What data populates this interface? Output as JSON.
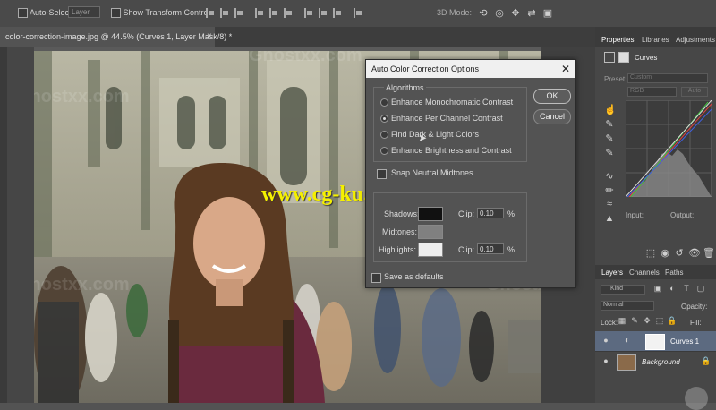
{
  "options_bar": {
    "auto_select_label": "Auto-Select:",
    "auto_select_value": "Layer",
    "show_transform_label": "Show Transform Controls",
    "mode_3d_label": "3D Mode:"
  },
  "document": {
    "tab_title": "color-correction-image.jpg @ 44.5% (Curves 1, Layer Mask/8) *",
    "close_glyph": "×"
  },
  "dialog": {
    "title": "Auto Color Correction Options",
    "close_glyph": "✕",
    "algorithms_label": "Algorithms",
    "options": [
      {
        "label": "Enhance Monochromatic Contrast",
        "selected": false
      },
      {
        "label": "Enhance Per Channel Contrast",
        "selected": true
      },
      {
        "label": "Find Dark & Light Colors",
        "selected": false
      },
      {
        "label": "Enhance Brightness and Contrast",
        "selected": false
      }
    ],
    "snap_label": "Snap Neutral Midtones",
    "shadows_label": "Shadows:",
    "midtones_label": "Midtones:",
    "highlights_label": "Highlights:",
    "clip_label": "Clip:",
    "shadows_clip": "0.10",
    "highlights_clip": "0.10",
    "percent": "%",
    "shadows_color": "#111111",
    "midtones_color": "#808080",
    "highlights_color": "#eeeeee",
    "save_defaults_label": "Save as defaults",
    "ok_label": "OK",
    "cancel_label": "Cancel"
  },
  "properties_panel": {
    "tabs": [
      "Properties",
      "Libraries",
      "Adjustments"
    ],
    "title": "Curves",
    "preset_label": "Preset:",
    "preset_value": "Custom",
    "channel_value": "RGB",
    "auto_label": "Auto",
    "input_label": "Input:",
    "output_label": "Output:"
  },
  "layers_panel": {
    "tabs": [
      "Layers",
      "Channels",
      "Paths"
    ],
    "kind_label": "Kind",
    "blend_mode": "Normal",
    "opacity_label": "Opacity:",
    "lock_label": "Lock:",
    "fill_label": "Fill:",
    "layers": [
      {
        "name": "Curves 1"
      },
      {
        "name": "Background"
      }
    ]
  },
  "overlay": {
    "url_text": "www.cg-ku.com",
    "watermark": "Ghostxx.com"
  }
}
